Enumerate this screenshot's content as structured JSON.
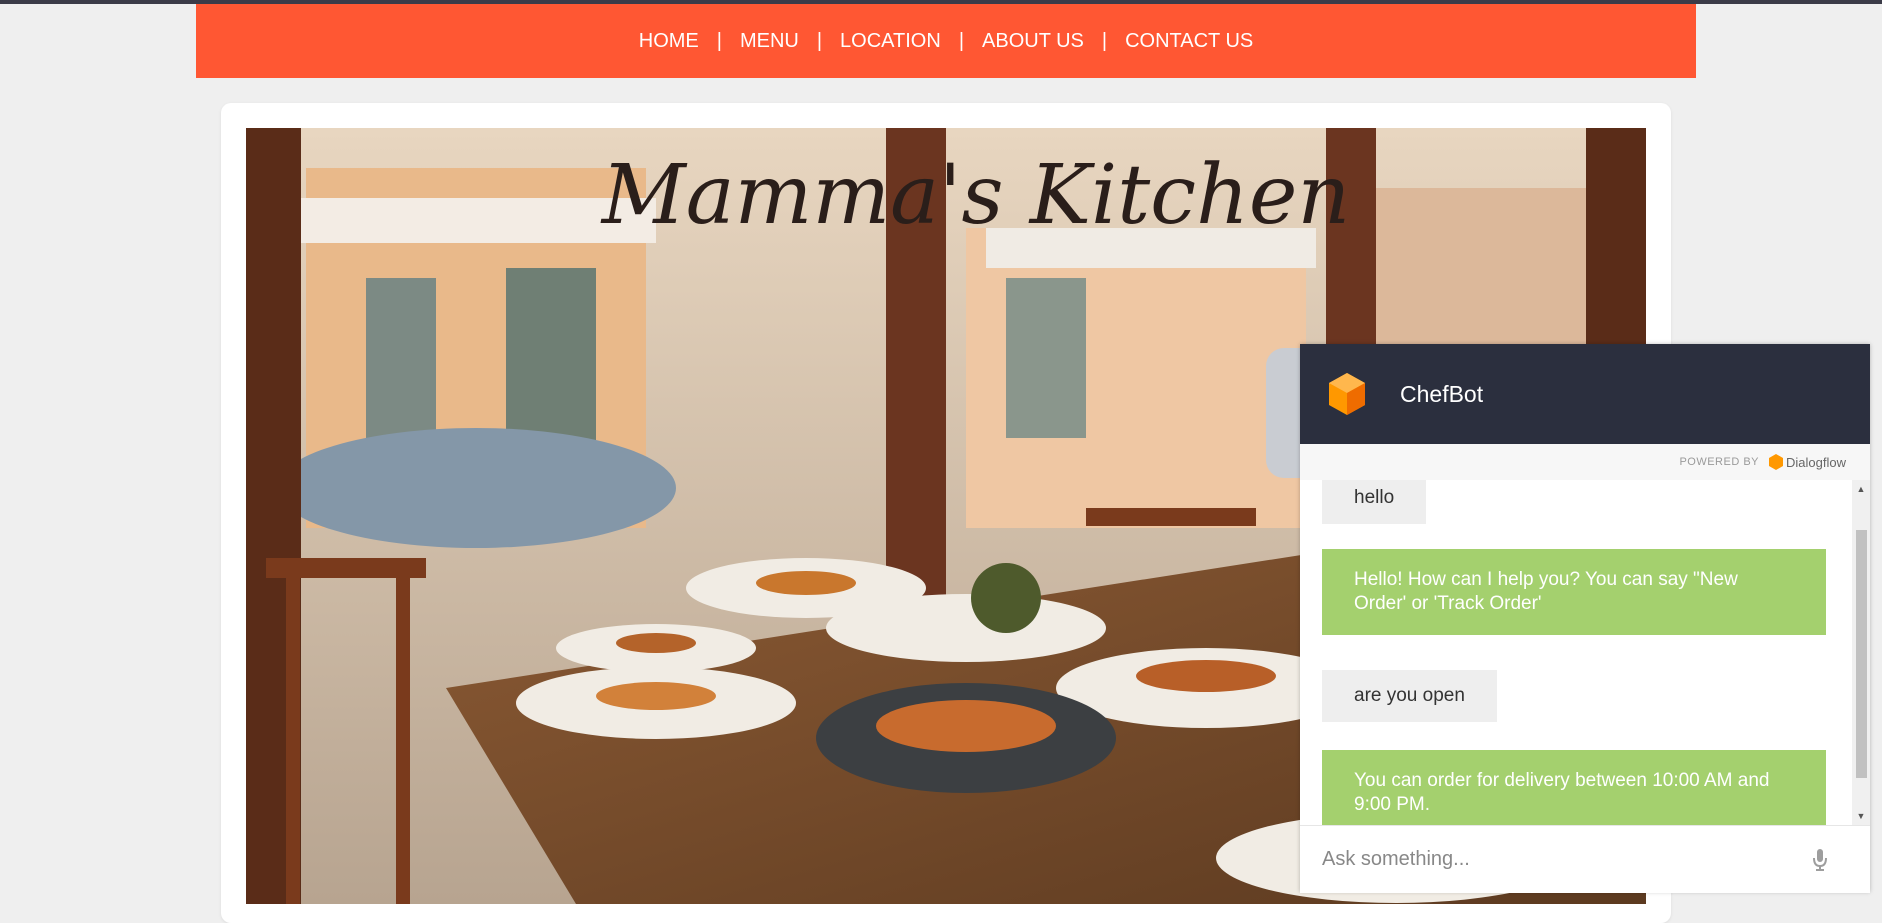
{
  "nav": {
    "items": [
      "HOME",
      "MENU",
      "LOCATION",
      "ABOUT US",
      "CONTACT US"
    ],
    "separator": "|",
    "background_color": "#ff5733"
  },
  "hero": {
    "logo_text": "Mamma's Kitchen"
  },
  "chat": {
    "title": "ChefBot",
    "powered_by": "POWERED BY",
    "provider": "Dialogflow",
    "header_color": "#2b2f3e",
    "bot_bubble_color": "#a4d06e",
    "user_bubble_color": "#eeeeee",
    "messages": [
      {
        "from": "user",
        "text": "hello"
      },
      {
        "from": "bot",
        "text": "Hello! How can I help you? You can say \"New Order' or 'Track Order'"
      },
      {
        "from": "user",
        "text": "are you open"
      },
      {
        "from": "bot",
        "text": "You can order for delivery between 10:00 AM and 9:00 PM."
      }
    ],
    "input_placeholder": "Ask something...",
    "icons": {
      "bot_logo": "dialogflow-cube-icon",
      "mic": "mic-icon",
      "scroll_up": "scroll-up-arrow-icon",
      "scroll_down": "scroll-down-arrow-icon"
    }
  }
}
